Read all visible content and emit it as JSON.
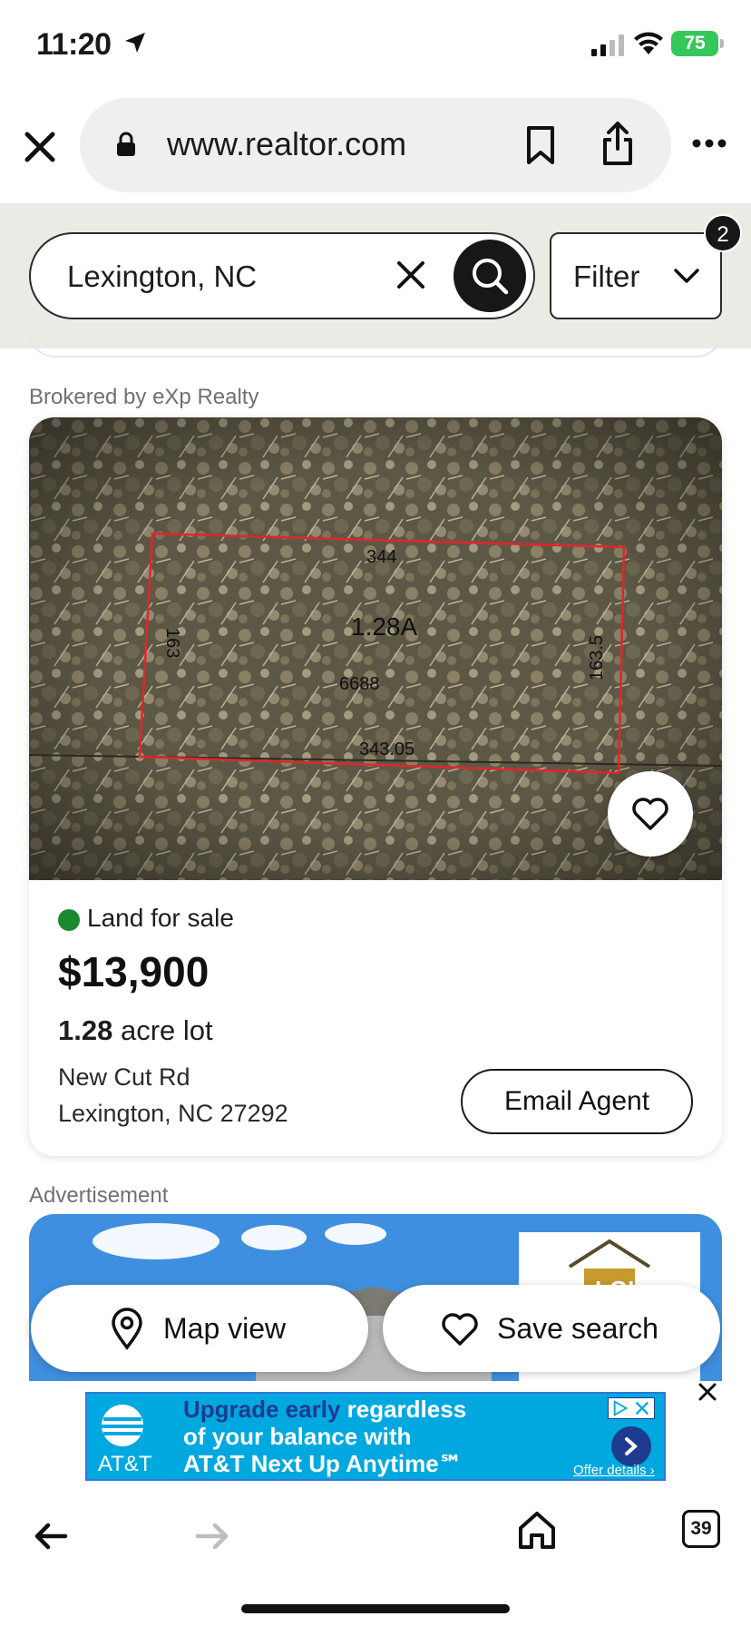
{
  "status_bar": {
    "time": "11:20",
    "battery": "75"
  },
  "browser": {
    "url": "www.realtor.com"
  },
  "search": {
    "query": "Lexington, NC",
    "filter_label": "Filter",
    "filter_count": "2"
  },
  "listing": {
    "brokered_by": "Brokered by eXp Realty",
    "photo_labels": {
      "top": "344",
      "area": "1.28A",
      "parcel": "6688",
      "bottom": "343.05",
      "left": "163",
      "right": "163.5"
    },
    "status": "Land for sale",
    "price": "$13,900",
    "lot_value": "1.28",
    "lot_unit": "acre lot",
    "address_line1": "New Cut Rd",
    "address_line2": "Lexington, NC 27292",
    "email_button": "Email Agent"
  },
  "ad": {
    "label": "Advertisement"
  },
  "floating": {
    "map_view": "Map view",
    "save_search": "Save search"
  },
  "att_ad": {
    "brand": "AT&T",
    "line1_highlight": "Upgrade early",
    "line1_rest": " regardless",
    "line2": "of your balance with",
    "line3": "AT&T Next Up Anytime℠",
    "offer": "Offer details ›"
  },
  "toolbar": {
    "tab_count": "39"
  },
  "colors": {
    "status_green": "#1b8a2e",
    "att_blue": "#00a8e0",
    "battery_green": "#34c759"
  }
}
